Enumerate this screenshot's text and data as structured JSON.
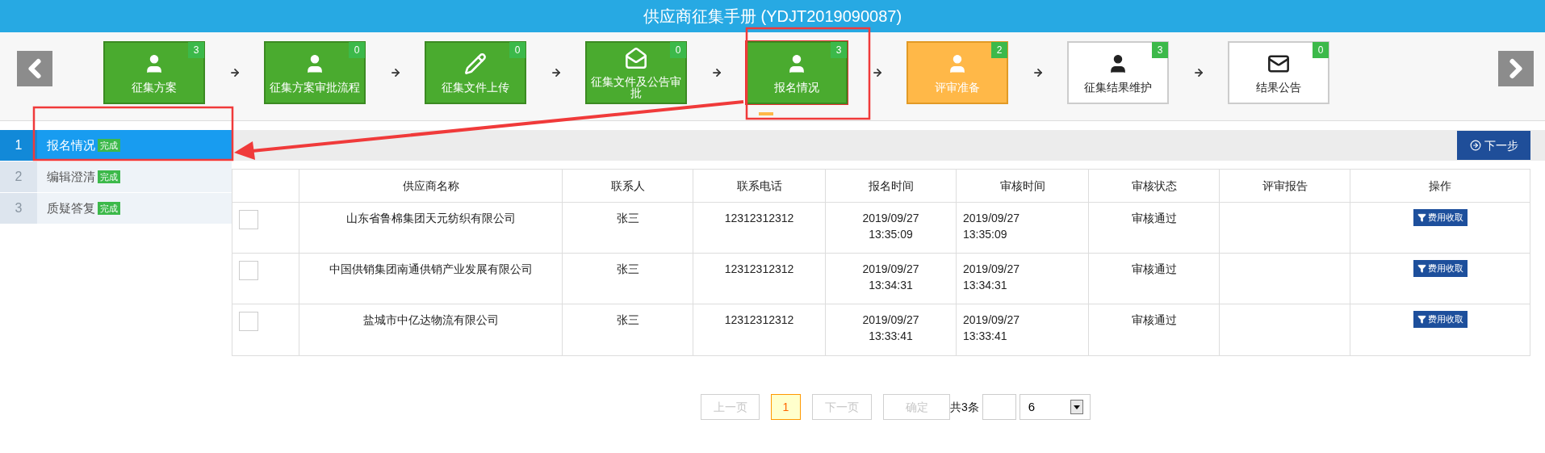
{
  "window": {
    "title": "供应商征集手册 (YDJT2019090087)"
  },
  "steps": [
    {
      "label": "征集方案",
      "count": "3",
      "kind": "done",
      "selected": false
    },
    {
      "label": "征集方案审批流程",
      "count": "0",
      "kind": "done",
      "selected": false
    },
    {
      "label": "征集文件上传",
      "count": "0",
      "kind": "done",
      "selected": false
    },
    {
      "label": "征集文件及公告审批",
      "count": "0",
      "kind": "done",
      "selected": false
    },
    {
      "label": "报名情况",
      "count": "3",
      "kind": "done",
      "selected": true
    },
    {
      "label": "评审准备",
      "count": "2",
      "kind": "active",
      "selected": false
    },
    {
      "label": "征集结果维护",
      "count": "3",
      "kind": "todo",
      "selected": false
    },
    {
      "label": "结果公告",
      "count": "0",
      "kind": "todo",
      "selected": false
    }
  ],
  "sidebar": {
    "items": [
      {
        "number": "1",
        "label": "报名情况",
        "badge": "完成",
        "selected": true
      },
      {
        "number": "2",
        "label": "编辑澄清",
        "badge": "完成",
        "selected": false
      },
      {
        "number": "3",
        "label": "质疑答复",
        "badge": "完成",
        "selected": false
      }
    ]
  },
  "toolbar": {
    "next_button": "下一步"
  },
  "table": {
    "columns": [
      "供应商名称",
      "联系人",
      "联系电话",
      "报名时间",
      "审核时间",
      "审核状态",
      "评审报告",
      "操作"
    ],
    "rows": [
      {
        "checked": false,
        "supplier": "山东省鲁棉集团天元纺织有限公司",
        "contact": "张三",
        "phone": "12312312312",
        "signup_time": "2019/09/27 13:35:09",
        "review_time": "2019/09/27 13:35:09",
        "status": "审核通过",
        "action": "费用收取"
      },
      {
        "checked": false,
        "supplier": "中国供销集团南通供销产业发展有限公司",
        "contact": "张三",
        "phone": "12312312312",
        "signup_time": "2019/09/27 13:34:31",
        "review_time": "2019/09/27 13:34:31",
        "status": "审核通过",
        "action": "费用收取"
      },
      {
        "checked": false,
        "supplier": "盐城市中亿达物流有限公司",
        "contact": "张三",
        "phone": "12312312312",
        "signup_time": "2019/09/27 13:33:41",
        "review_time": "2019/09/27 13:33:41",
        "status": "审核通过",
        "action": "费用收取"
      }
    ]
  },
  "pagination": {
    "prev": {
      "label": "上一页",
      "disabled": true
    },
    "pages": [
      {
        "label": "1",
        "selected": true
      }
    ],
    "next": {
      "label": "下一页",
      "disabled": true
    },
    "confirm": {
      "label": "确定",
      "disabled": true
    },
    "total": "共3条",
    "page_size": "6"
  }
}
